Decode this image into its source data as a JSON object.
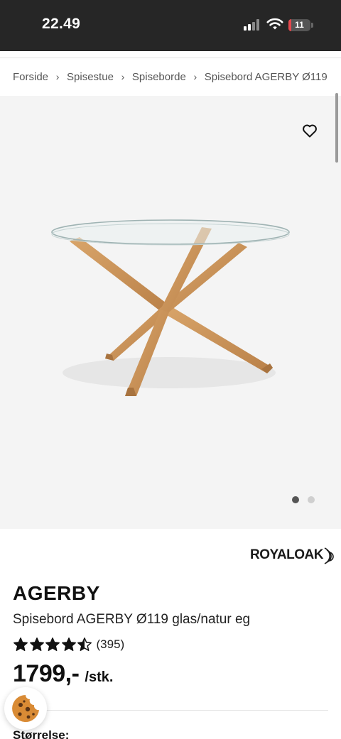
{
  "status_bar": {
    "time": "22.49",
    "battery_level": "11",
    "icons": [
      "signal-icon",
      "wifi-icon",
      "battery-icon"
    ]
  },
  "breadcrumb": {
    "items": [
      "Forside",
      "Spisestue",
      "Spiseborde",
      "Spisebord AGERBY Ø119"
    ],
    "separator": "›"
  },
  "gallery": {
    "image_count": 2,
    "active_index": 0,
    "icons": [
      "heart-icon"
    ]
  },
  "product": {
    "brand_logo_text": "ROYALOAK",
    "name": "AGERBY",
    "subtitle": "Spisebord AGERBY Ø119 glas/natur eg",
    "rating": 4.5,
    "rating_max": 5,
    "review_count": "(395)",
    "price": "1799,-",
    "price_unit": "/stk."
  },
  "options": {
    "size_label": "Størrelse:"
  },
  "cookie_button": {
    "icon": "cookie-icon"
  },
  "colors": {
    "status_bar_bg": "#262626",
    "gallery_bg": "#f4f4f4",
    "battery_low": "#e5484d",
    "wood": "#c8955c"
  }
}
